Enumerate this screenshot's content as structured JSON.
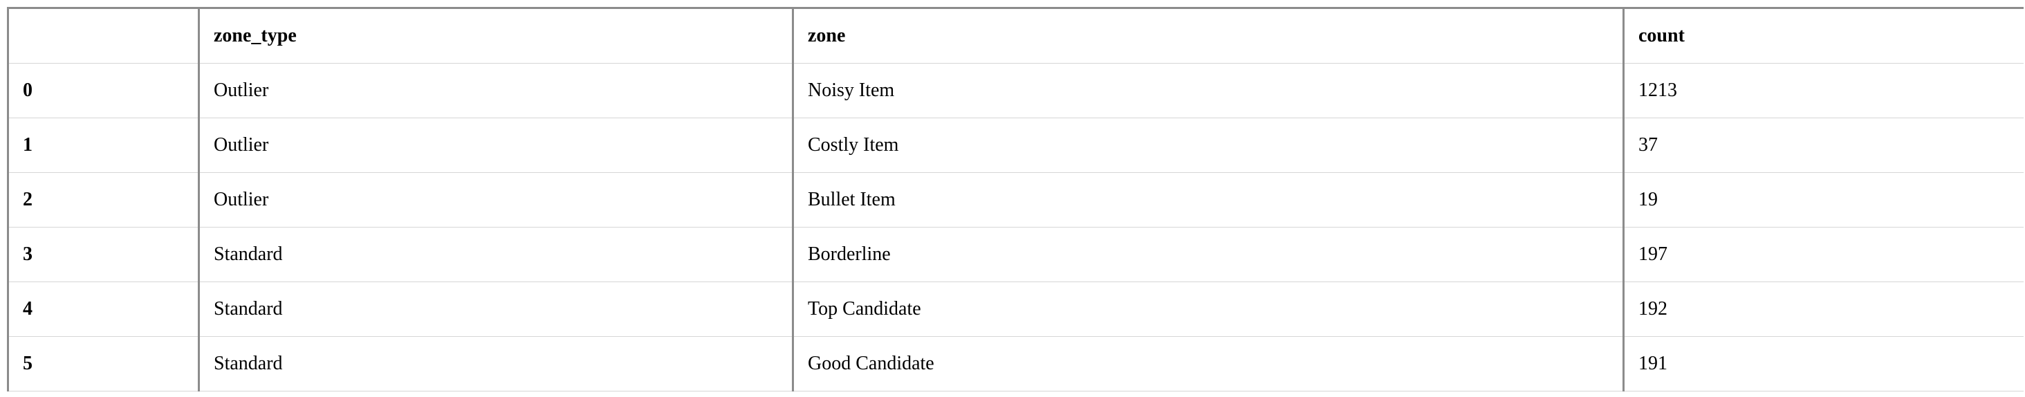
{
  "table": {
    "columns": [
      "",
      "zone_type",
      "zone",
      "count"
    ],
    "rows": [
      {
        "index": "0",
        "zone_type": "Outlier",
        "zone": "Noisy Item",
        "count": "1213"
      },
      {
        "index": "1",
        "zone_type": "Outlier",
        "zone": "Costly Item",
        "count": "37"
      },
      {
        "index": "2",
        "zone_type": "Outlier",
        "zone": "Bullet Item",
        "count": "19"
      },
      {
        "index": "3",
        "zone_type": "Standard",
        "zone": "Borderline",
        "count": "197"
      },
      {
        "index": "4",
        "zone_type": "Standard",
        "zone": "Top Candidate",
        "count": "192"
      },
      {
        "index": "5",
        "zone_type": "Standard",
        "zone": "Good Candidate",
        "count": "191"
      }
    ]
  }
}
